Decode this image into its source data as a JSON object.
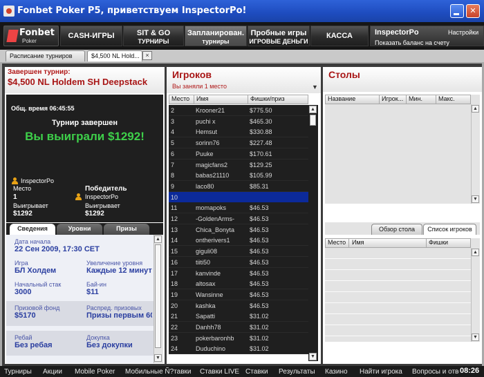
{
  "window": {
    "title": "Fonbet Poker P5, приветствуем InspectorPo!"
  },
  "logo": {
    "name": "Fonbet",
    "sub": "Poker"
  },
  "menu": [
    {
      "l1": "CASH-ИГРЫ",
      "l2": ""
    },
    {
      "l1": "SIT & GO",
      "l2": "ТУРНИРЫ"
    },
    {
      "l1": "Запланирован.",
      "l2": "турниры"
    },
    {
      "l1": "Пробные игры",
      "l2": "ИГРОВЫЕ ДЕНЬГИ"
    },
    {
      "l1": "КАССА",
      "l2": ""
    }
  ],
  "account": {
    "name": "InspectorPo",
    "settings": "Настройки",
    "balance": "Показать баланс на счету"
  },
  "tabs": {
    "schedule": "Расписание турниров",
    "current": "$4,500 NL Hold...",
    "close": "×"
  },
  "tournament": {
    "header_line1": "Завершен турнир:",
    "header_line2": "$4,500 NL Holdem SH Deepstack",
    "total_time": "Общ. время  06:45:55",
    "finished": "Турнир завершен",
    "won": "Вы выиграли $1292!",
    "player": {
      "name": "InspectorPo",
      "place_label": "Место",
      "place": "1",
      "wins_label": "Выигрывает",
      "wins": "$1292"
    },
    "winner": {
      "title": "Победитель",
      "name": "InspectorPo",
      "wins_label": "Выигрывает",
      "wins": "$1292"
    }
  },
  "subtabs": [
    "Сведения",
    "Уровни",
    "Призы"
  ],
  "details": {
    "start_label": "Дата начала",
    "start": "22 Сен 2009, 17:30 CET",
    "game_label": "Игра",
    "game": "БЛ Холдем",
    "levels_label": "Увеличение уровня",
    "levels": "Каждые 12 минут",
    "stack_label": "Начальный стак",
    "stack": "3000",
    "buyin_label": "Бай-ин",
    "buyin": "$11",
    "prize_label": "Призовой фонд",
    "prize": "$5170",
    "dist_label": "Распред. призовых",
    "dist": "Призы первым 60",
    "rebuy_label": "Ребай",
    "rebuy": "Без ребая",
    "addon_label": "Докупка",
    "addon": "Без докупки"
  },
  "players": {
    "title": "Игроков",
    "subtitle": "Вы заняли 1 место",
    "columns": [
      "Место",
      "Имя",
      "Фишки/приз"
    ],
    "rows": [
      [
        "2",
        "Krooner21",
        "$775.50"
      ],
      [
        "3",
        "puchi x",
        "$465.30"
      ],
      [
        "4",
        "Hemsut",
        "$330.88"
      ],
      [
        "5",
        "sorinn76",
        "$227.48"
      ],
      [
        "6",
        "Puuke",
        "$170.61"
      ],
      [
        "7",
        "magicfans2",
        "$129.25"
      ],
      [
        "8",
        "babas21110",
        "$105.99"
      ],
      [
        "9",
        "laco80",
        "$85.31"
      ],
      [
        "10",
        "",
        ""
      ],
      [
        "11",
        "momapoks",
        "$46.53"
      ],
      [
        "12",
        "-GoldenArms-",
        "$46.53"
      ],
      [
        "13",
        "Chica_Bonyta",
        "$46.53"
      ],
      [
        "14",
        "ontherivers1",
        "$46.53"
      ],
      [
        "15",
        "giguli08",
        "$46.53"
      ],
      [
        "16",
        "tiiti50",
        "$46.53"
      ],
      [
        "17",
        "kanvinde",
        "$46.53"
      ],
      [
        "18",
        "altosax",
        "$46.53"
      ],
      [
        "19",
        "Wansinne",
        "$46.53"
      ],
      [
        "20",
        "kashka",
        "$46.53"
      ],
      [
        "21",
        "Sapatti",
        "$31.02"
      ],
      [
        "22",
        "Danhh78",
        "$31.02"
      ],
      [
        "23",
        "pokerbaronhb",
        "$31.02"
      ],
      [
        "24",
        "Duduchino",
        "$31.02"
      ]
    ]
  },
  "tables": {
    "title": "Столы",
    "columns": [
      "Название",
      "Игрок...",
      "Мин.",
      "Макс."
    ],
    "tabs": [
      "Обзор стола",
      "Список игроков"
    ],
    "list_columns": [
      "Место",
      "Имя",
      "Фишки"
    ]
  },
  "status": {
    "items": [
      "Турниры",
      "Акции",
      "Mobile Poker",
      "Мобильные Ñ?тавки",
      "Ставки LIVE",
      "Ставки",
      "Результаты",
      "Казино",
      "Найти игрока",
      "Вопросы и ответы"
    ],
    "clock": "08:26"
  }
}
